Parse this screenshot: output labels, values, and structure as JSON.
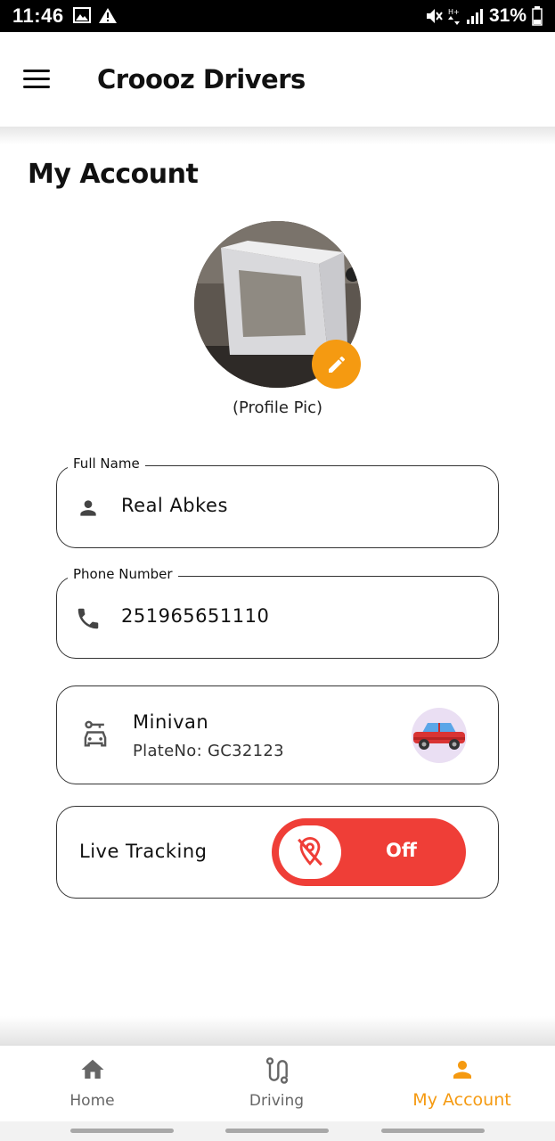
{
  "status_bar": {
    "time": "11:46",
    "battery": "31%",
    "icons": [
      "image-icon",
      "warning-icon",
      "mute-icon",
      "data-arrows-icon",
      "signal-icon",
      "battery-icon"
    ]
  },
  "app_bar": {
    "title": "Croooz Drivers",
    "menu_icon": "hamburger-menu-icon"
  },
  "page": {
    "title": "My Account",
    "profile_caption": "(Profile Pic)"
  },
  "fields": {
    "full_name": {
      "label": "Full Name",
      "value": "Real Abkes",
      "icon": "person-icon"
    },
    "phone": {
      "label": "Phone Number",
      "value": "251965651110",
      "icon": "phone-icon"
    }
  },
  "vehicle": {
    "name": "Minivan",
    "plate": "PlateNo: GC32123",
    "icon": "car-key-icon",
    "badge_icon": "red-car-icon"
  },
  "live_tracking": {
    "label": "Live Tracking",
    "state": "Off",
    "icon": "location-off-icon",
    "color": "#ef3e37"
  },
  "bottom_nav": {
    "items": [
      {
        "label": "Home",
        "icon": "home-icon"
      },
      {
        "label": "Driving",
        "icon": "route-icon"
      },
      {
        "label": "My Account",
        "icon": "person-icon"
      }
    ],
    "active_index": 2,
    "accent_color": "#f59a11"
  }
}
